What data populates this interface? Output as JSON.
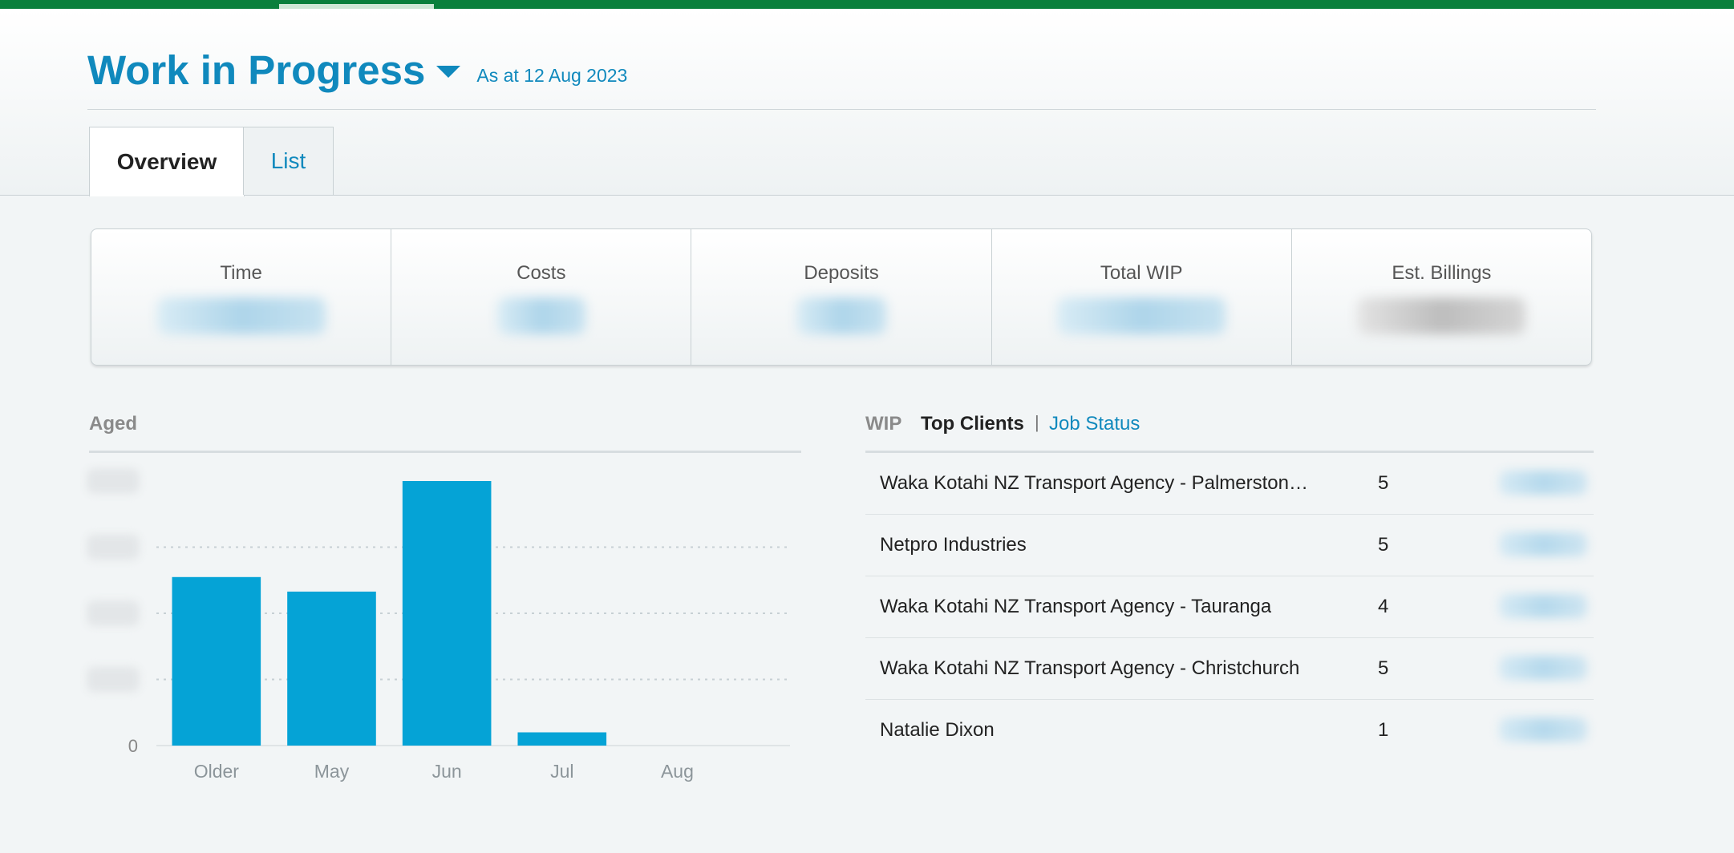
{
  "header": {
    "title": "Work in Progress",
    "as_at": "As at 12 Aug 2023"
  },
  "tabs": {
    "overview": "Overview",
    "list": "List"
  },
  "summary": {
    "time_label": "Time",
    "costs_label": "Costs",
    "deposits_label": "Deposits",
    "total_wip_label": "Total WIP",
    "est_billings_label": "Est. Billings"
  },
  "aged": {
    "title": "Aged"
  },
  "chart_data": {
    "type": "bar",
    "title": "Aged",
    "categories": [
      "Older",
      "May",
      "Jun",
      "Jul",
      "Aug"
    ],
    "values": [
      0.637,
      0.582,
      1.0,
      0.05,
      0
    ],
    "ylim": [
      0,
      1.0
    ],
    "y_tick_labels_visible": [
      "0"
    ],
    "grid": true,
    "bar_color": "#05a3d6"
  },
  "top_clients": {
    "wip_label": "WIP",
    "active_tab": "Top Clients",
    "separator": "|",
    "other_tab": "Job Status",
    "rows": [
      {
        "name": "Waka Kotahi NZ Transport Agency - Palmerston North",
        "count": "5"
      },
      {
        "name": "Netpro Industries",
        "count": "5"
      },
      {
        "name": "Waka Kotahi NZ Transport Agency - Tauranga",
        "count": "4"
      },
      {
        "name": "Waka Kotahi NZ Transport Agency - Christchurch",
        "count": "5"
      },
      {
        "name": "Natalie Dixon",
        "count": "1"
      }
    ]
  },
  "colors": {
    "brand_green": "#0a7f3c",
    "accent_blue": "#1089bd",
    "bar_blue": "#05a3d6"
  }
}
